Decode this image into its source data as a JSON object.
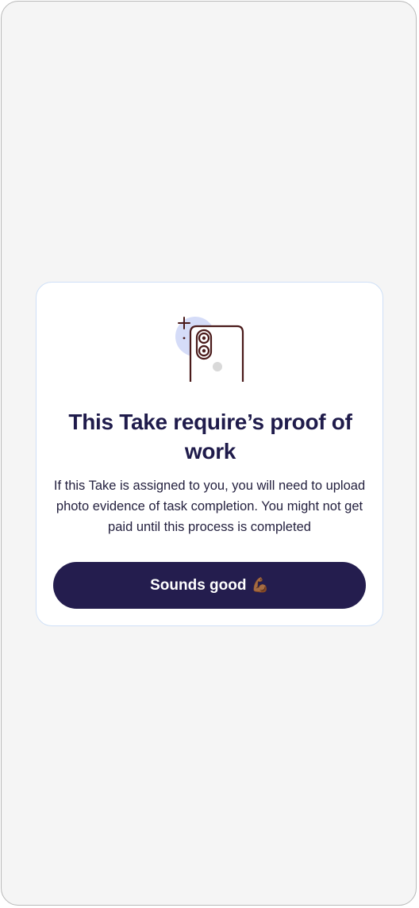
{
  "modal": {
    "illustration_icon": "phone-camera-icon",
    "title": "This Take require’s proof of work",
    "body": "If this Take is assigned to you, you will need to upload photo evidence of task completion. You might not get paid until this process is completed",
    "button": {
      "label": "Sounds good",
      "emoji": "💪🏾"
    }
  },
  "colors": {
    "primary": "#241d4e",
    "title_text": "#1f1b4b",
    "modal_border": "#cfe0f7",
    "illustration_blob": "#d5dcf8",
    "illustration_outline": "#4a1a1a",
    "background": "#f5f5f5"
  }
}
